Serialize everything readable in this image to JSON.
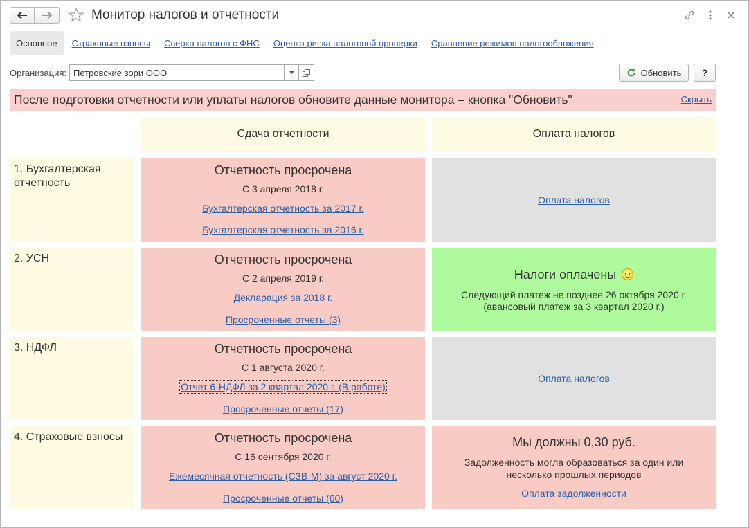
{
  "window": {
    "title": "Монитор налогов и отчетности"
  },
  "tabs": [
    {
      "label": "Основное",
      "active": true
    },
    {
      "label": "Страховые взносы",
      "active": false
    },
    {
      "label": "Сверка налогов с ФНС",
      "active": false
    },
    {
      "label": "Оценка риска налоговой проверки",
      "active": false
    },
    {
      "label": "Сравнение режимов налогообложения",
      "active": false
    }
  ],
  "organization": {
    "label": "Организация:",
    "value": "Петровские зори ООО"
  },
  "toolbar": {
    "refresh_label": "Обновить",
    "help_label": "?"
  },
  "banner": {
    "text": "После подготовки отчетности или уплаты налогов обновите данные монитора – кнопка \"Обновить\"",
    "hide_label": "Скрыть"
  },
  "columns": {
    "reporting": "Сдача отчетности",
    "payment": "Оплата налогов"
  },
  "rows": [
    {
      "label": "1. Бухгалтерская отчетность",
      "reporting": {
        "status": "Отчетность просрочена",
        "since": "С 3 апреля 2018 г.",
        "link1": "Бухгалтерская отчетность за 2017 г.",
        "link2": "Бухгалтерская отчетность за 2016 г."
      },
      "payment": {
        "link": "Оплата налогов"
      }
    },
    {
      "label": "2. УСН",
      "reporting": {
        "status": "Отчетность просрочена",
        "since": "С 2 апреля 2019 г.",
        "link1": "Декларация за 2018 г.",
        "link2": "Просроченные отчеты (3)"
      },
      "payment": {
        "status": "Налоги оплачены",
        "line1": "Следующий платеж не позднее 26 октября 2020 г.",
        "line2": "(авансовый платеж за 3 квартал 2020 г.)"
      }
    },
    {
      "label": "3. НДФЛ",
      "reporting": {
        "status": "Отчетность просрочена",
        "since": "С 1 августа 2020 г.",
        "link1": "Отчет 6-НДФЛ за 2 квартал 2020 г. (В работе)",
        "link2": "Просроченные отчеты (17)"
      },
      "payment": {
        "link": "Оплата налогов"
      }
    },
    {
      "label": "4. Страховые взносы",
      "reporting": {
        "status": "Отчетность просрочена",
        "since": "С 16 сентября 2020 г.",
        "link1": "Ежемесячная отчетность (СЗВ-М) за август 2020 г.",
        "link2": "Просроченные отчеты (60)"
      },
      "payment": {
        "status": "Мы должны 0,30 руб.",
        "line1": "Задолженность могла образоваться за один или",
        "line2": "несколько прошлых периодов",
        "link": "Оплата задолженности"
      }
    }
  ],
  "icons": {
    "back": "arrow-left-icon",
    "forward": "arrow-right-icon",
    "favorite": "star-icon",
    "link": "link-icon",
    "more": "more-vertical-icon",
    "close": "close-icon",
    "refresh": "refresh-icon"
  },
  "colors": {
    "overdue": "#f9cbc5",
    "neutral": "#e1e1e1",
    "paid": "#aefa9c",
    "header": "#fefbe2",
    "banner": "#f9d0ce",
    "link": "#2b5fa6"
  }
}
